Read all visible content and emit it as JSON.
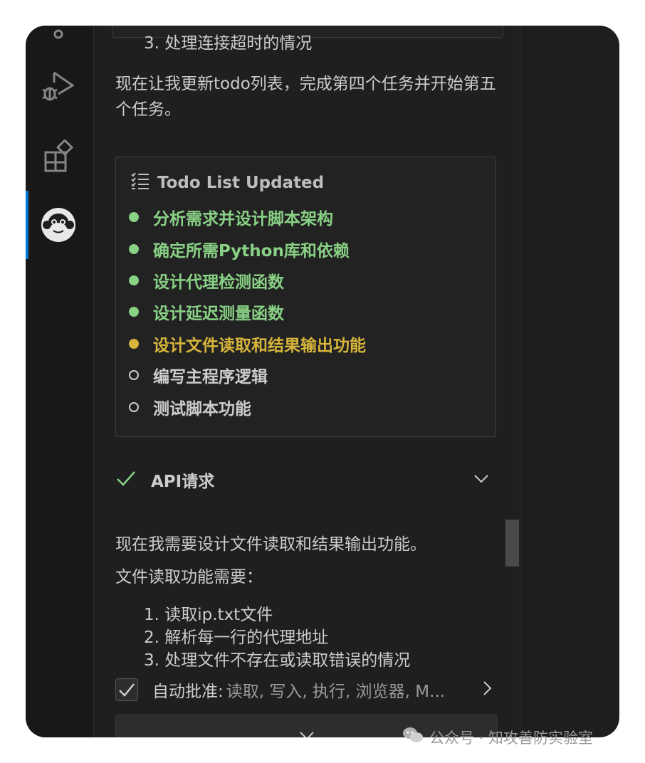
{
  "previous": {
    "list_item_3": "3. 处理连接超时的情况"
  },
  "intro_text": "现在让我更新todo列表，完成第四个任务并开始第五个任务。",
  "todo": {
    "header": "Todo List Updated",
    "items": [
      {
        "label": "分析需求并设计脚本架构",
        "status": "completed",
        "color": "#89d185"
      },
      {
        "label": "确定所需Python库和依赖",
        "status": "completed",
        "color": "#89d185"
      },
      {
        "label": "设计代理检测函数",
        "status": "completed",
        "color": "#89d185"
      },
      {
        "label": "设计延迟测量函数",
        "status": "completed",
        "color": "#89d185"
      },
      {
        "label": "设计文件读取和结果输出功能",
        "status": "in_progress",
        "color": "#d7b53b"
      },
      {
        "label": "编写主程序逻辑",
        "status": "pending",
        "color": "#cccccc"
      },
      {
        "label": "测试脚本功能",
        "status": "pending",
        "color": "#cccccc"
      }
    ]
  },
  "api_request": {
    "title": "API请求",
    "icon": "checkmark-icon",
    "status_color": "#89d185"
  },
  "message": {
    "line1": "现在我需要设计文件读取和结果输出功能。",
    "line2": "文件读取功能需要：",
    "list": [
      "1. 读取ip.txt文件",
      "2. 解析每一行的代理地址",
      "3. 处理文件不存在或读取错误的情况"
    ]
  },
  "auto_approve": {
    "label": "自动批准:",
    "value": "读取, 写入, 执行, 浏览器, M...",
    "checked": true
  },
  "watermark": "公众号 · 知攻善防实验室",
  "colors": {
    "accent": "#0078d4",
    "done": "#89d185",
    "in_progress": "#d7b53b"
  }
}
